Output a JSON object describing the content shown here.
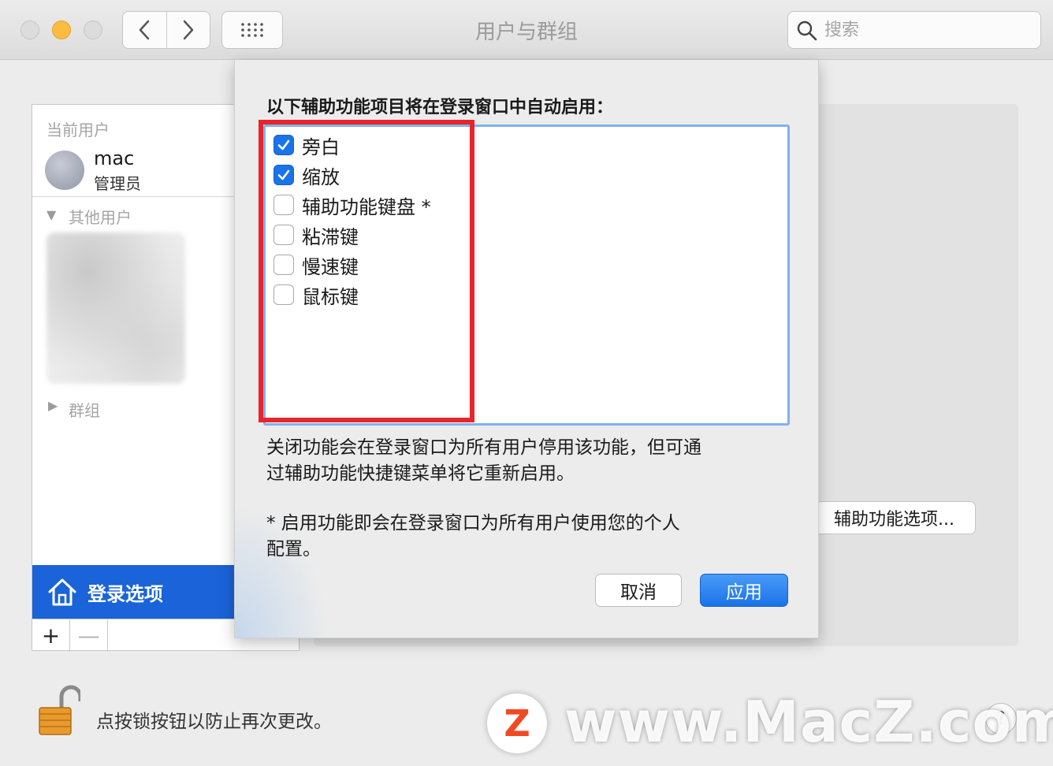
{
  "window": {
    "title": "用户与群组",
    "search_placeholder": "搜索"
  },
  "sidebar": {
    "current_users_label": "当前用户",
    "current_user": {
      "name": "mac",
      "role": "管理员"
    },
    "other_users_label": "其他用户",
    "groups_label": "群组",
    "login_options_label": "登录选项",
    "add_label": "+",
    "remove_label": "—"
  },
  "main": {
    "accessibility_options_button": "辅助功能选项..."
  },
  "footer": {
    "lock_text": "点按锁按钮以防止再次更改。",
    "help_label": "?"
  },
  "watermark": {
    "logo_letter": "Z",
    "text": "www.MacZ.com"
  },
  "dialog": {
    "title": "以下辅助功能项目将在登录窗口中自动启用：",
    "items": [
      {
        "label": "旁白",
        "checked": true
      },
      {
        "label": "缩放",
        "checked": true
      },
      {
        "label": "辅助功能键盘 *",
        "checked": false
      },
      {
        "label": "粘滞键",
        "checked": false
      },
      {
        "label": "慢速键",
        "checked": false
      },
      {
        "label": "鼠标键",
        "checked": false
      }
    ],
    "description_line1": "关闭功能会在登录窗口为所有用户停用该功能，但可通",
    "description_line2": "过辅助功能快捷键菜单将它重新启用。",
    "note_line1": "* 启用功能即会在登录窗口为所有用户使用您的个人",
    "note_line2": "配置。",
    "cancel_label": "取消",
    "apply_label": "应用"
  },
  "colors": {
    "accent": "#1a73e8",
    "highlight_box": "#e8252c",
    "sidebar_selected": "#1a63d8"
  }
}
